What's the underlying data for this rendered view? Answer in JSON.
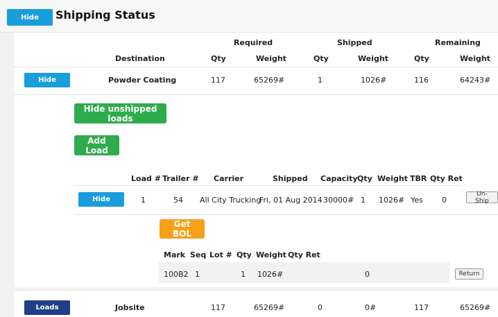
{
  "header": {
    "hide_button": "Hide",
    "title": "Shipping Status"
  },
  "table_header": {
    "group_required": "Required",
    "group_shipped": "Shipped",
    "group_remaining": "Remaining",
    "destination": "Destination",
    "req_qty": "Qty",
    "req_weight": "Weight",
    "ship_qty": "Qty",
    "ship_weight": "Weight",
    "rem_qty": "Qty",
    "rem_weight": "Weight"
  },
  "destinations": [
    {
      "button": "Hide",
      "name": "Powder Coating",
      "req_qty": "117",
      "req_weight": "65269#",
      "ship_qty": "1",
      "ship_weight": "1026#",
      "rem_qty": "116",
      "rem_weight": "64243#"
    },
    {
      "button": "Loads",
      "name": "Jobsite",
      "req_qty": "117",
      "req_weight": "65269#",
      "ship_qty": "0",
      "ship_weight": "0#",
      "rem_qty": "117",
      "rem_weight": "65269#"
    }
  ],
  "actions": {
    "hide_unshipped": "Hide unshipped loads",
    "add_load": "Add Load"
  },
  "loads_header": {
    "load_no": "Load #",
    "trailer_no": "Trailer #",
    "carrier": "Carrier",
    "shipped": "Shipped",
    "capacity": "Capacity",
    "qty": "Qty",
    "weight": "Weight",
    "tbr": "TBR",
    "qty_ret": "Qty Ret"
  },
  "load": {
    "button": "Hide",
    "load_no": "1",
    "trailer_no": "54",
    "carrier": "All City Trucking",
    "shipped": "Fri, 01 Aug 2014",
    "capacity": "30000#",
    "qty": "1",
    "weight": "1026#",
    "tbr": "Yes",
    "qty_ret": "0",
    "unship": "Un-Ship"
  },
  "bol": {
    "button": "Get BOL"
  },
  "marks_header": {
    "mark": "Mark",
    "seq": "Seq",
    "lot": "Lot #",
    "qty": "Qty",
    "weight": "Weight",
    "qty_ret": "Qty Ret"
  },
  "mark_row": {
    "mark": "100B2",
    "seq": "1",
    "lot": "",
    "qty": "1",
    "weight": "1026#",
    "qty_ret": "0",
    "return": "Return"
  }
}
